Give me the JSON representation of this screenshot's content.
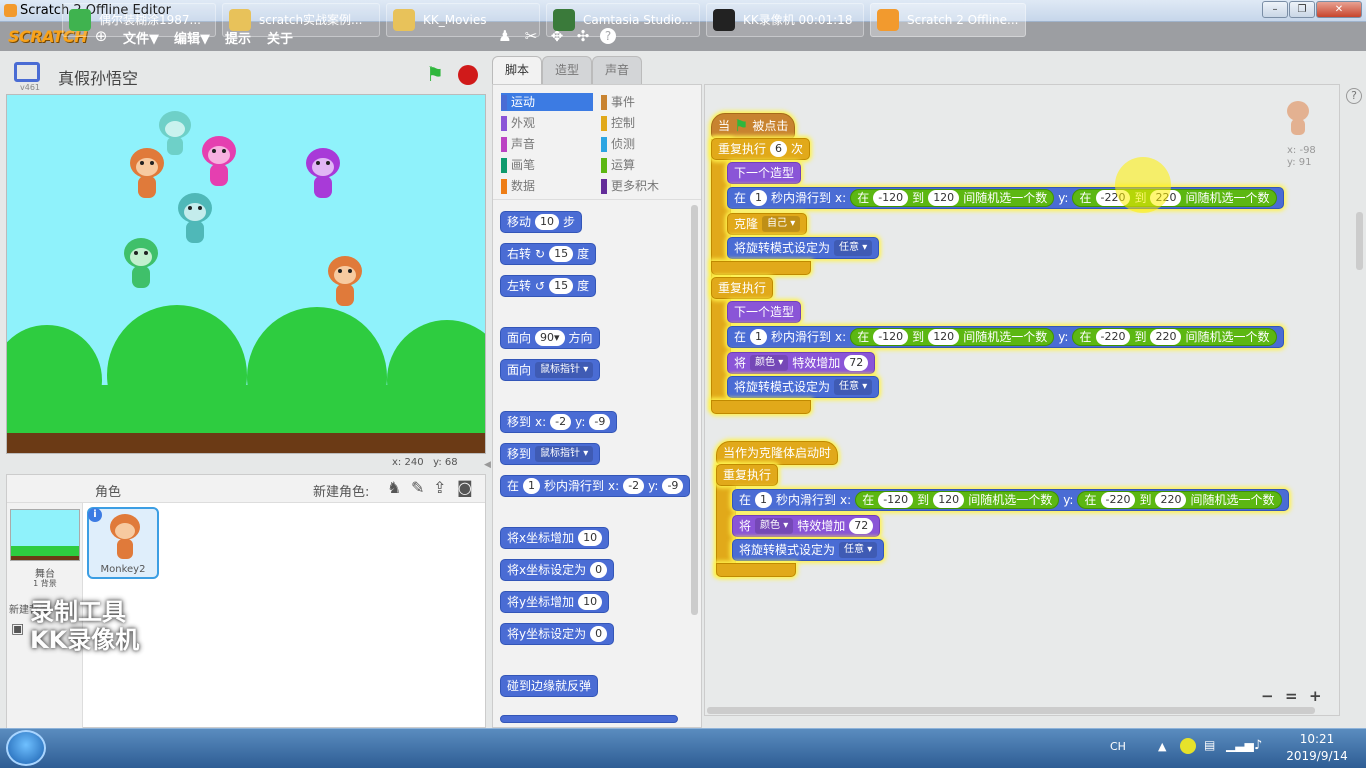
{
  "window": {
    "title": "Scratch 2 Offline Editor",
    "buttons": [
      "–",
      "❐",
      "✕"
    ]
  },
  "menubar": {
    "logo": "SCRATCH",
    "items": [
      "文件▼",
      "编辑▼",
      "提示",
      "关于"
    ]
  },
  "stage_header": {
    "sprite_name": "真假孙悟空",
    "version": "v461"
  },
  "stage_coords": {
    "x_label": "x:",
    "x": "240",
    "y_label": "y:",
    "y": "68"
  },
  "sprite_pane": {
    "title": "角色",
    "new_sprite_label": "新建角色:",
    "stage_label": "舞台",
    "stage_sub": "1 背景",
    "new_backdrop_label": "新建背景:",
    "sprite_thumb_label": "Monkey2"
  },
  "tabs": [
    "脚本",
    "造型",
    "声音"
  ],
  "categories": {
    "left": [
      {
        "label": "运动",
        "color": "#4a6cd4"
      },
      {
        "label": "外观",
        "color": "#8a55d7"
      },
      {
        "label": "声音",
        "color": "#bb42c3"
      },
      {
        "label": "画笔",
        "color": "#0e9a6c"
      },
      {
        "label": "数据",
        "color": "#ee7d16"
      }
    ],
    "right": [
      {
        "label": "事件",
        "color": "#c88330"
      },
      {
        "label": "控制",
        "color": "#e1a91a"
      },
      {
        "label": "侦测",
        "color": "#2ca5e2"
      },
      {
        "label": "运算",
        "color": "#5cb712"
      },
      {
        "label": "更多积木",
        "color": "#632d99"
      }
    ]
  },
  "palette_blocks": {
    "move": {
      "a": "移动",
      "v": "10",
      "b": "步"
    },
    "turn_right": {
      "a": "右转",
      "icon": "↻",
      "v": "15",
      "b": "度"
    },
    "turn_left": {
      "a": "左转",
      "icon": "↺",
      "v": "15",
      "b": "度"
    },
    "point_dir": {
      "a": "面向",
      "v": "90▾",
      "b": "方向"
    },
    "point_towards": {
      "a": "面向",
      "d": "鼠标指针 ▾"
    },
    "goto_xy": {
      "a": "移到",
      "x": "x:",
      "xv": "-2",
      "y": "y:",
      "yv": "-9"
    },
    "goto": {
      "a": "移到",
      "d": "鼠标指针 ▾"
    },
    "glide": {
      "a": "在",
      "v": "1",
      "b": "秒内滑行到",
      "x": "x:",
      "xv": "-2",
      "y": "y:",
      "yv": "-9"
    },
    "change_x": {
      "a": "将x坐标增加",
      "v": "10"
    },
    "set_x": {
      "a": "将x坐标设定为",
      "v": "0"
    },
    "change_y": {
      "a": "将y坐标增加",
      "v": "10"
    },
    "set_y": {
      "a": "将y坐标设定为",
      "v": "0"
    },
    "bounce": {
      "a": "碰到边缘就反弹"
    }
  },
  "scripts": {
    "hat1": {
      "a": "当",
      "b": "被点击"
    },
    "repeat": {
      "a": "重复执行",
      "v": "6",
      "b": "次"
    },
    "next_costume": "下一个造型",
    "glide": {
      "a": "在",
      "v": "1",
      "b": "秒内滑行到",
      "x": "x:",
      "y": "y:",
      "rand_a": "在",
      "rand_b": "到",
      "rand_c": "间随机选一个数",
      "x1": "-120",
      "x2": "120",
      "y1": "-220",
      "y2": "220"
    },
    "clone": {
      "a": "克隆",
      "d": "自己 ▾"
    },
    "rotation": {
      "a": "将旋转模式设定为",
      "d": "任意 ▾"
    },
    "forever": "重复执行",
    "effect": {
      "a": "将",
      "d": "颜色 ▾",
      "b": "特效增加",
      "v": "72"
    },
    "clone_hat": "当作为克隆体启动时"
  },
  "sprite_info": {
    "x": "x: -98",
    "y": "y: 91"
  },
  "zoom": {
    "out": "−",
    "reset": "=",
    "in": "+"
  },
  "taskbar": {
    "tasks": [
      {
        "label": "偶尔装糊涂1987...",
        "color": "#3fb34f"
      },
      {
        "label": "scratch实战案例...",
        "color": "#e8c25a"
      },
      {
        "label": "KK_Movies",
        "color": "#e8c25a"
      },
      {
        "label": "Camtasia Studio...",
        "color": "#3a7a3a"
      },
      {
        "label": "KK录像机 00:01:18",
        "color": "#222"
      },
      {
        "label": "Scratch 2 Offline...",
        "color": "#f29a2e"
      }
    ],
    "ime": "CH",
    "time": "10:21",
    "date": "2019/9/14"
  },
  "watermark": {
    "line1": "录制工具",
    "line2": "KK录像机"
  }
}
